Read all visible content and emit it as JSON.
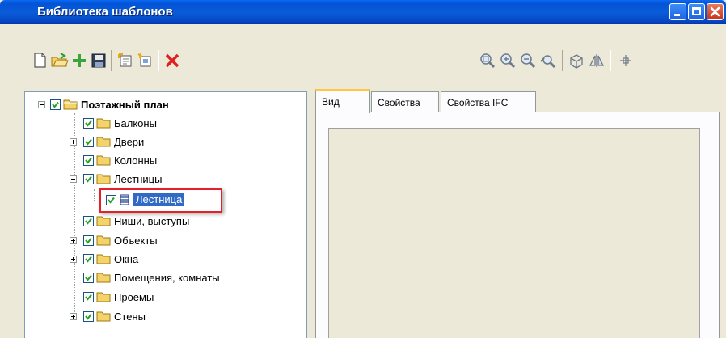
{
  "window": {
    "title": "Библиотека шаблонов"
  },
  "toolbar": {
    "left_icons": [
      "new-file-icon",
      "open-folder-icon",
      "add-icon",
      "save-icon",
      "sep",
      "properties-icon",
      "reload-icon",
      "sep",
      "delete-icon"
    ],
    "right_icons": [
      "zoom-extent-icon",
      "zoom-in-icon",
      "zoom-out-icon",
      "zoom-window-icon",
      "sep",
      "view-3d-icon",
      "mirror-icon",
      "sep",
      "center-icon"
    ]
  },
  "tree": {
    "root": "Поэтажный план",
    "items": [
      {
        "label": "Балконы",
        "expandable": false
      },
      {
        "label": "Двери",
        "expandable": true
      },
      {
        "label": "Колонны",
        "expandable": false
      },
      {
        "label": "Лестницы",
        "expandable": true,
        "expanded": true
      },
      {
        "label": "Лестница",
        "child": true,
        "selected": true
      },
      {
        "label": "Ниши, выступы",
        "expandable": false
      },
      {
        "label": "Объекты",
        "expandable": true
      },
      {
        "label": "Окна",
        "expandable": true
      },
      {
        "label": "Помещения, комнаты",
        "expandable": false
      },
      {
        "label": "Проемы",
        "expandable": false
      },
      {
        "label": "Стены",
        "expandable": true
      }
    ]
  },
  "tabs": [
    {
      "label": "Вид",
      "active": true
    },
    {
      "label": "Свойства",
      "active": false
    },
    {
      "label": "Свойства IFC",
      "active": false
    }
  ],
  "colors": {
    "title_bar": "#0a5cd8",
    "selection": "#316ac5",
    "highlight": "#e2212a",
    "folder": "#f5d36b",
    "tab_active_accent": "#ffc83c"
  }
}
